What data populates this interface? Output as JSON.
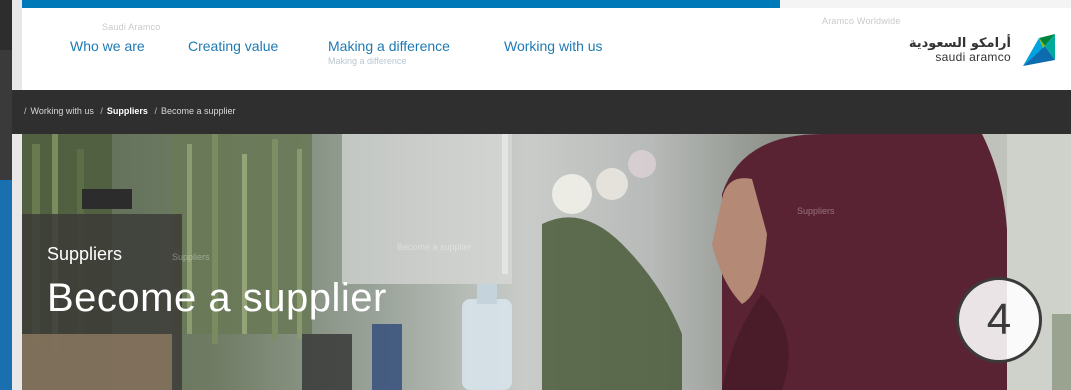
{
  "header": {
    "top_faint_left": "Saudi Aramco",
    "top_faint_right": "Aramco Worldwide",
    "nav": [
      {
        "label": "Who we are",
        "sub": ""
      },
      {
        "label": "Creating value",
        "sub": ""
      },
      {
        "label": "Making a difference",
        "sub": "Making a difference"
      },
      {
        "label": "Working with us",
        "sub": ""
      }
    ],
    "logo": {
      "arabic": "أرامكو السعودية",
      "latin": "saudi aramco"
    }
  },
  "breadcrumb": {
    "items": [
      "Working with us",
      "Suppliers",
      "Become a supplier"
    ],
    "separator": "/"
  },
  "hero": {
    "eyebrow": "Suppliers",
    "title": "Become a supplier"
  },
  "badge": {
    "number": "4"
  },
  "colors": {
    "accent": "#0079b8",
    "nav_text": "#1d7ab3",
    "breadcrumb_bg": "#2f2f2f"
  }
}
